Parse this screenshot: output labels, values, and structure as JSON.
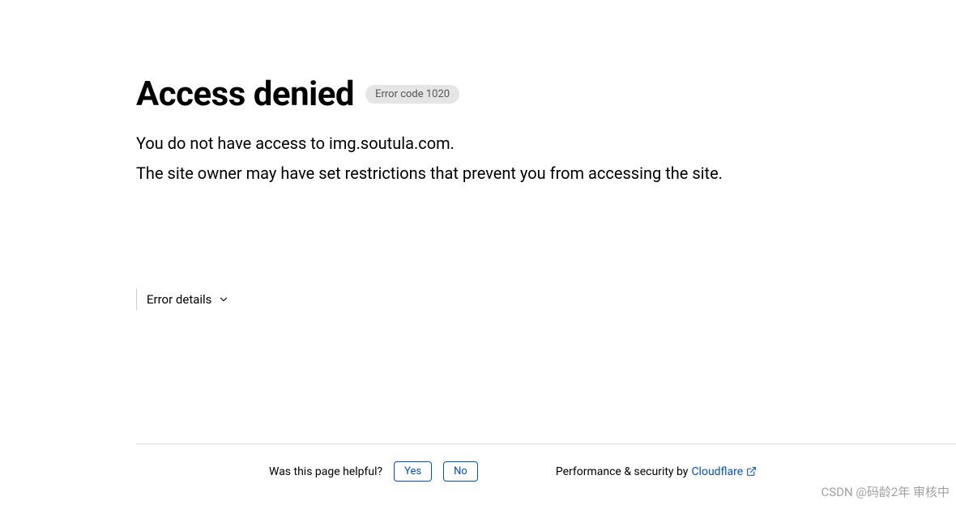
{
  "header": {
    "title": "Access denied",
    "error_badge": "Error code 1020"
  },
  "body": {
    "line1": "You do not have access to img.soutula.com.",
    "line2": "The site owner may have set restrictions that prevent you from accessing the site."
  },
  "details": {
    "toggle_label": "Error details"
  },
  "footer": {
    "helpful_prompt": "Was this page helpful?",
    "yes_label": "Yes",
    "no_label": "No",
    "security_prefix": "Performance & security by ",
    "cloudflare_label": "Cloudflare"
  },
  "watermark": "CSDN @码龄2年 审核中"
}
